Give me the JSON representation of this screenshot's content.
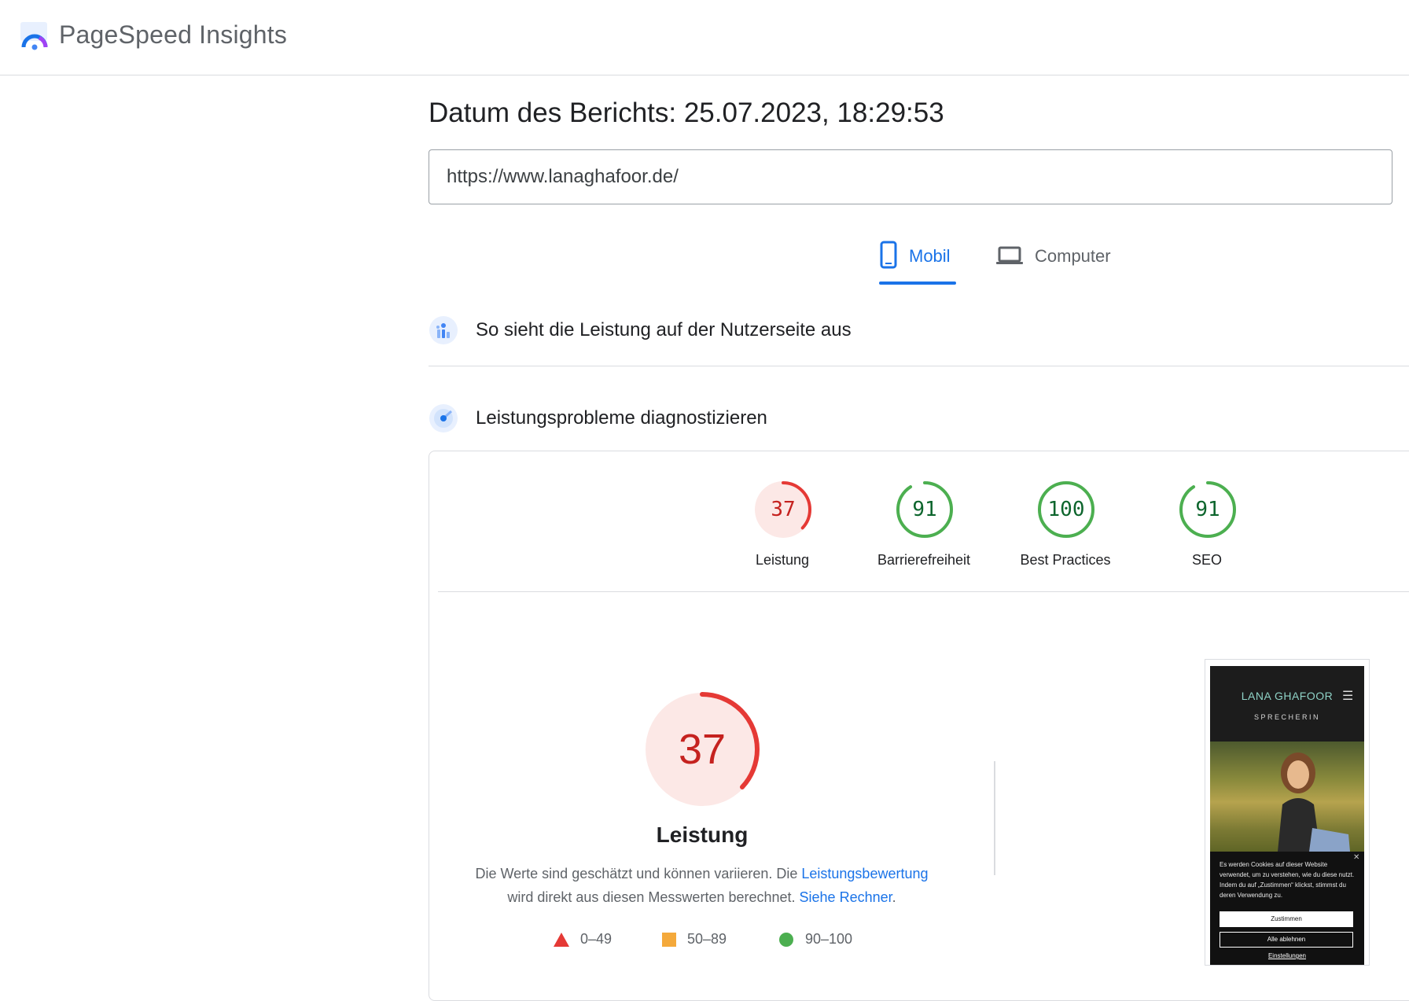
{
  "header": {
    "app_title": "PageSpeed Insights",
    "logo_icon": "pagespeed-logo-icon"
  },
  "report": {
    "date_label": "Datum des Berichts: 25.07.2023, 18:29:53"
  },
  "url_input": {
    "value": "https://www.lanaghafoor.de/"
  },
  "tabs": [
    {
      "label": "Mobil",
      "icon": "phone-icon",
      "active": true
    },
    {
      "label": "Computer",
      "icon": "laptop-icon",
      "active": false
    }
  ],
  "sections": {
    "field_data": {
      "title": "So sieht die Leistung auf der Nutzerseite aus",
      "icon": "crux-icon"
    },
    "diagnose": {
      "title": "Leistungsprobleme diagnostizieren",
      "icon": "lighthouse-icon"
    }
  },
  "scores": [
    {
      "label": "Leistung",
      "value": 37,
      "color": "#c5221f"
    },
    {
      "label": "Barrierefreiheit",
      "value": 91,
      "color": "#0d652d"
    },
    {
      "label": "Best Practices",
      "value": 100,
      "color": "#0d652d"
    },
    {
      "label": "SEO",
      "value": 91,
      "color": "#0d652d"
    }
  ],
  "performance": {
    "score": 37,
    "title": "Leistung",
    "desc_part1": "Die Werte sind geschätzt und können variieren. Die ",
    "desc_link1": "Leistungsbewertung",
    "desc_part2": " wird direkt aus diesen Messwerten berechnet. ",
    "desc_link2": "Siehe Rechner",
    "desc_part3": "."
  },
  "legend": [
    {
      "range": "0–49",
      "shape": "triangle",
      "color": "#e53935"
    },
    {
      "range": "50–89",
      "shape": "square",
      "color": "#f4a93b"
    },
    {
      "range": "90–100",
      "shape": "circle",
      "color": "#4caf50"
    }
  ],
  "screenshot": {
    "brand": "LANA GHAFOOR",
    "subtitle": "SPRECHERIN",
    "cookie_text": "Es werden Cookies auf dieser Website verwendet, um zu verstehen, wie du diese nutzt. Indem du auf „Zustimmen“ klickst, stimmst du deren Verwendung zu.",
    "accept_label": "Zustimmen",
    "reject_label": "Alle ablehnen",
    "settings_label": "Einstellungen"
  },
  "colors": {
    "accent": "#1a73e8",
    "fail": "#c5221f",
    "pass": "#0d652d",
    "fail_ring": "#e53935",
    "pass_ring": "#4caf50"
  }
}
